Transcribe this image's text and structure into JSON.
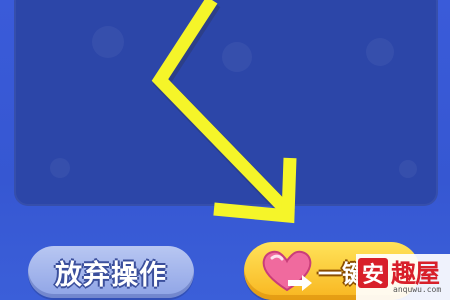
{
  "game": {
    "buttons": {
      "abandon_label": "放弃操作",
      "onekey_label": "一键"
    },
    "hint_arrow": {
      "icon": "arrow-icon",
      "color": "#f5f529"
    },
    "watermark": {
      "badge_char": "安",
      "name": "趣屋",
      "url": "anquwu.com"
    },
    "colors": {
      "background": "#3a5ad6",
      "board": "#2c46a8",
      "abandon_button": "#a7b8ee",
      "onekey_button": "#fbc73a",
      "heart": "#f06a9e"
    }
  }
}
